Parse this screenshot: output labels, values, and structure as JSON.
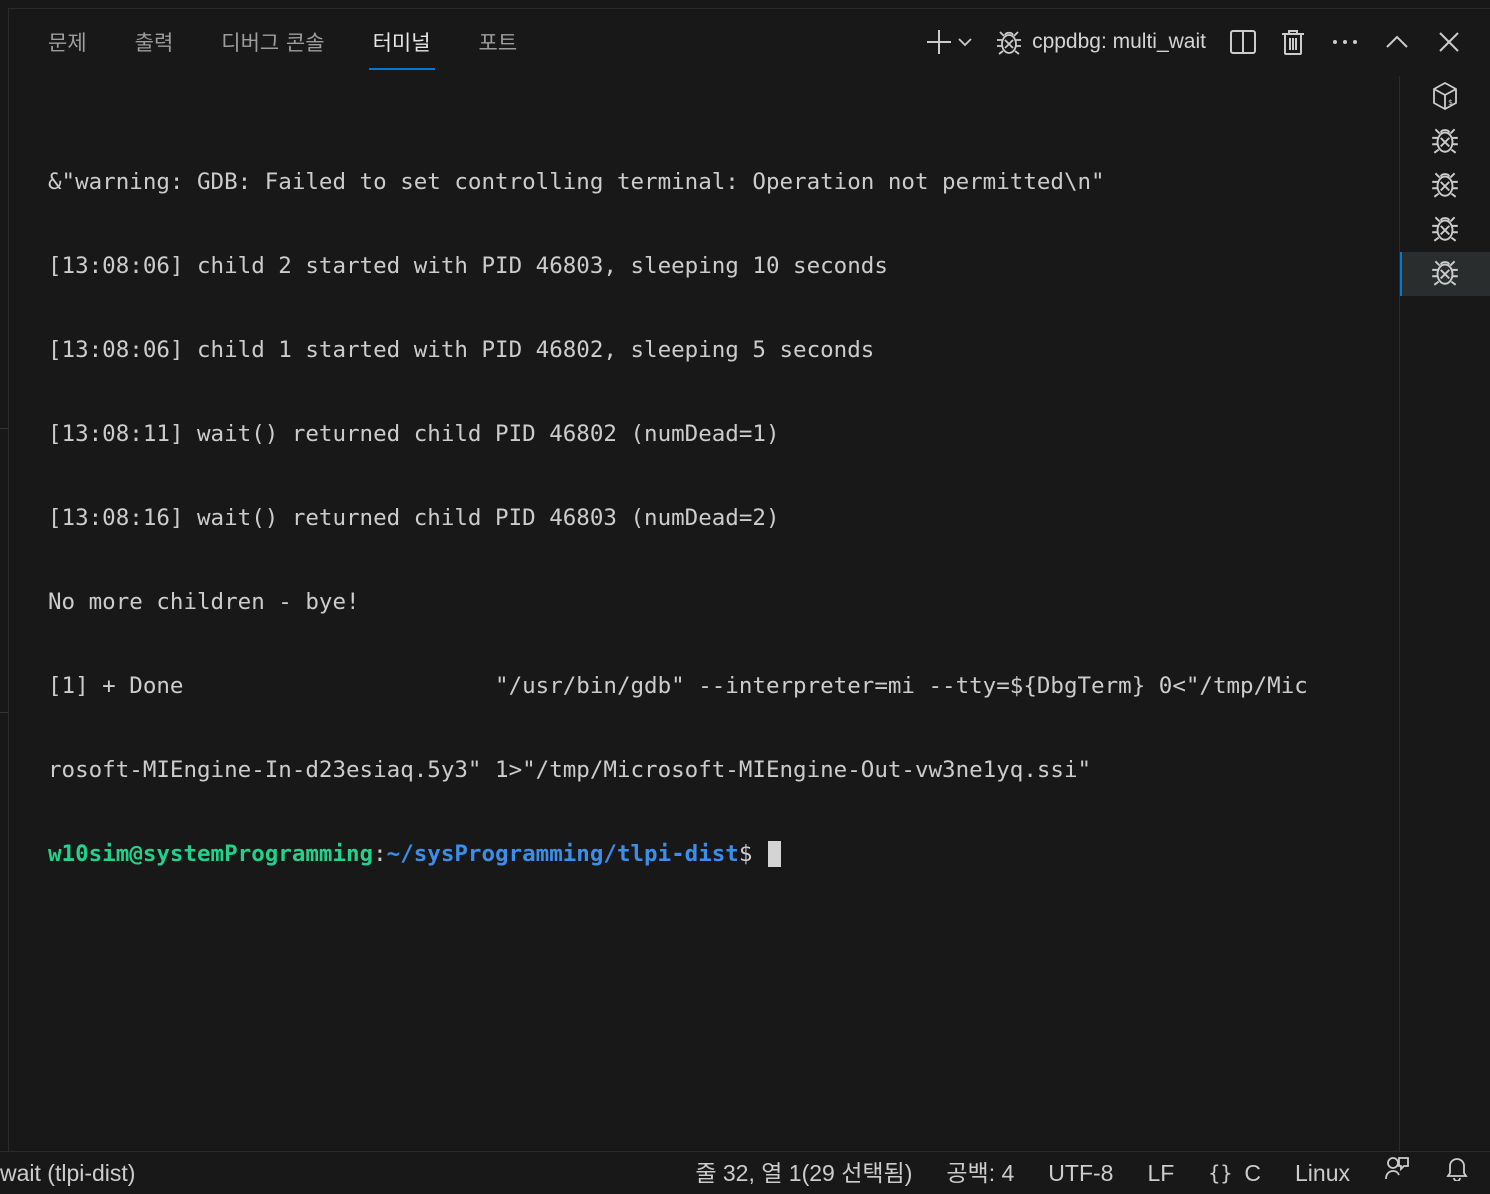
{
  "tabs": [
    {
      "label": "문제",
      "active": false
    },
    {
      "label": "출력",
      "active": false
    },
    {
      "label": "디버그 콘솔",
      "active": false
    },
    {
      "label": "터미널",
      "active": true
    },
    {
      "label": "포트",
      "active": false
    }
  ],
  "toolbar": {
    "terminal_name": "cppdbg: multi_wait"
  },
  "terminal": {
    "lines": [
      "&\"warning: GDB: Failed to set controlling terminal: Operation not permitted\\n\"",
      "[13:08:06] child 2 started with PID 46803, sleeping 10 seconds",
      "[13:08:06] child 1 started with PID 46802, sleeping 5 seconds",
      "[13:08:11] wait() returned child PID 46802 (numDead=1)",
      "[13:08:16] wait() returned child PID 46803 (numDead=2)",
      "No more children - bye!",
      "[1] + Done                       \"/usr/bin/gdb\" --interpreter=mi --tty=${DbgTerm} 0<\"/tmp/Mic",
      "rosoft-MIEngine-In-d23esiaq.5y3\" 1>\"/tmp/Microsoft-MIEngine-Out-vw3ne1yq.ssi\""
    ],
    "prompt_user": "w10sim@systemProgramming",
    "prompt_sep": ":",
    "prompt_path": "~/sysProgramming/tlpi-dist",
    "prompt_symbol": "$ "
  },
  "terminal_list": [
    {
      "icon": "shell-icon",
      "active": false
    },
    {
      "icon": "debug-icon",
      "active": false
    },
    {
      "icon": "debug-icon",
      "active": false
    },
    {
      "icon": "debug-icon",
      "active": false
    },
    {
      "icon": "debug-icon",
      "active": true
    }
  ],
  "statusbar": {
    "left_label": "wait (tlpi-dist)",
    "cursor_position": "줄 32, 열 1(29 선택됨)",
    "indentation": "공백: 4",
    "encoding": "UTF-8",
    "eol": "LF",
    "language": "C",
    "platform": "Linux"
  },
  "colors": {
    "background": "#181818",
    "accent": "#0078d4",
    "prompt_user": "#23d18b",
    "prompt_path": "#3b8eea"
  }
}
